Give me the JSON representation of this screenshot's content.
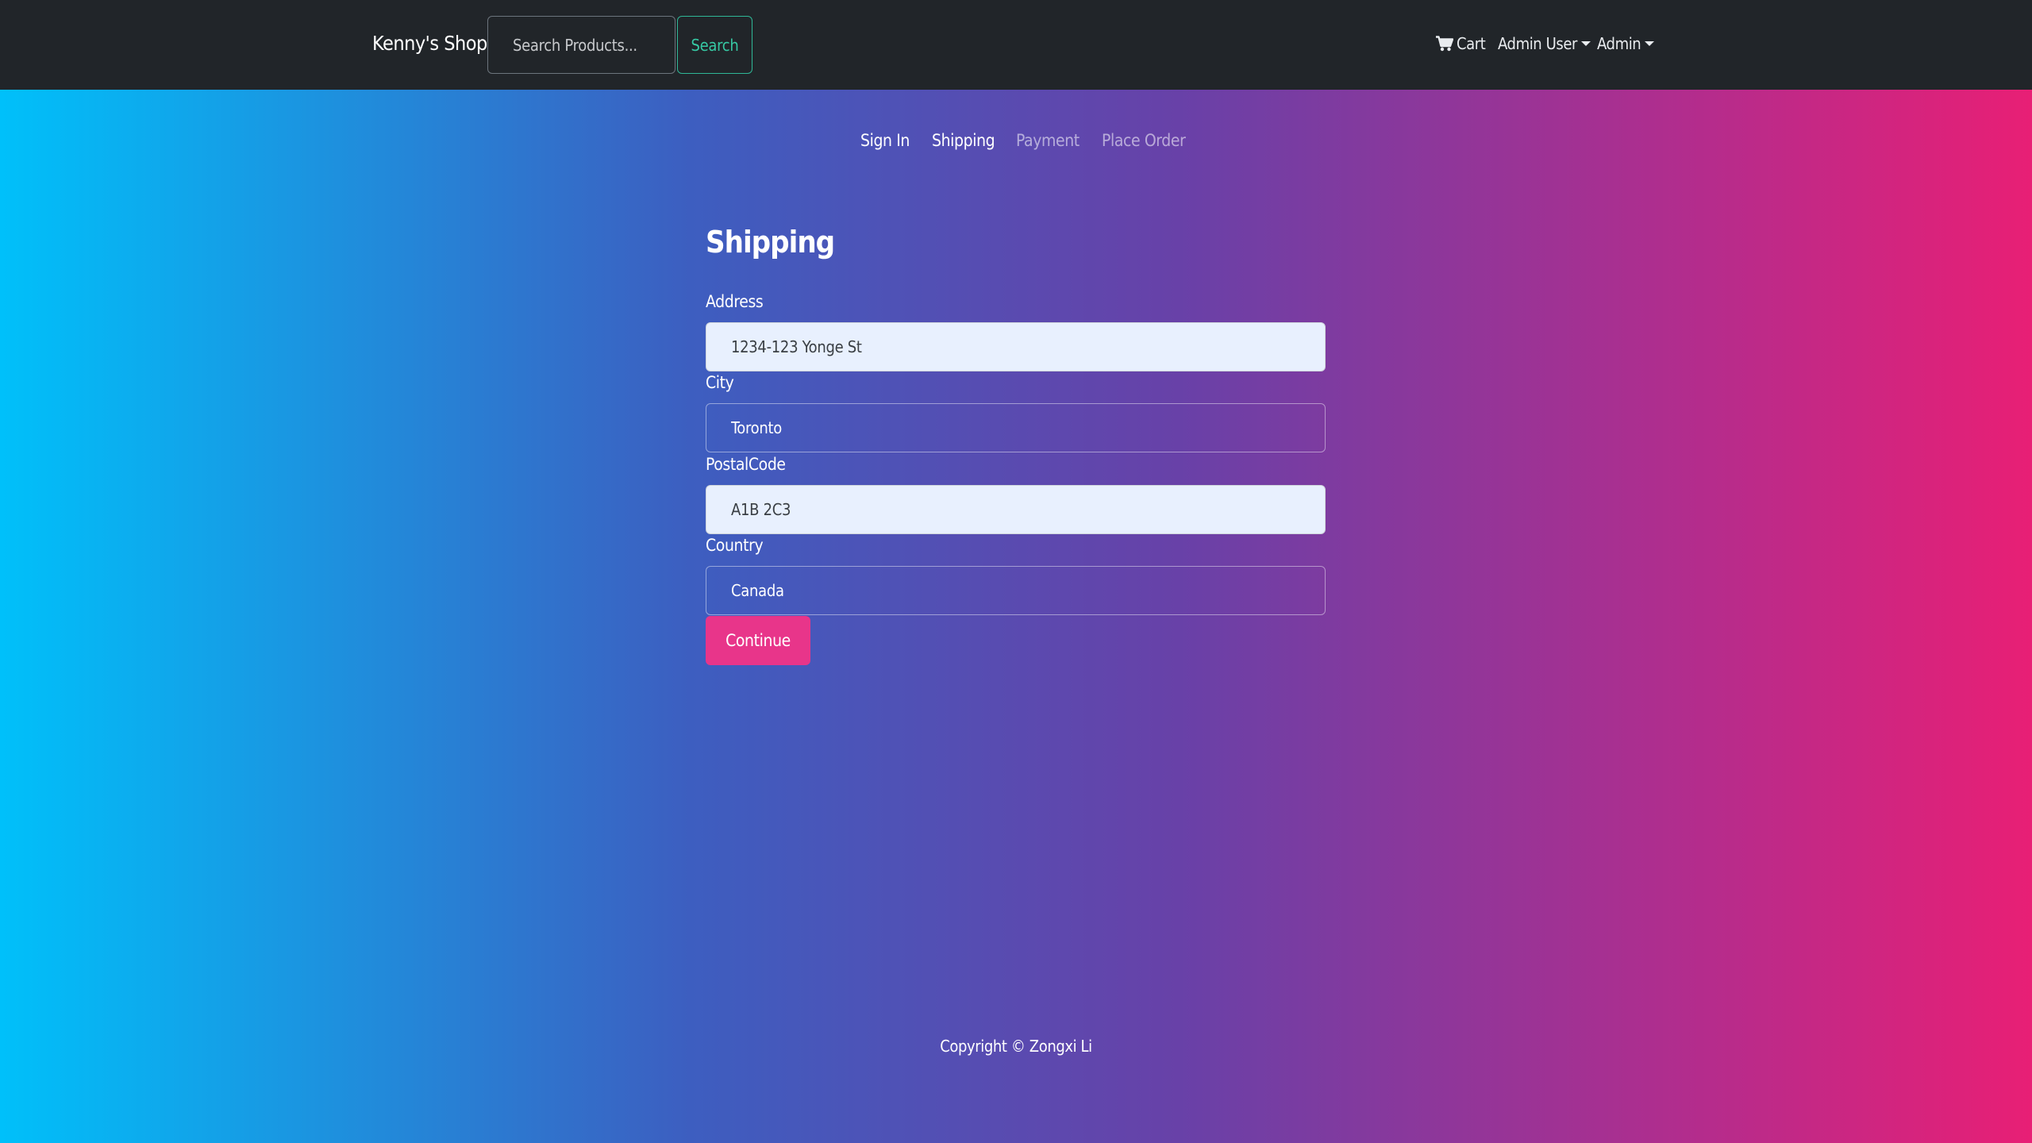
{
  "navbar": {
    "brand": "Kenny's Shop",
    "search_placeholder": "Search Products...",
    "search_button": "Search",
    "cart_label": "Cart",
    "user_menu_label": "Admin User",
    "admin_menu_label": "Admin"
  },
  "steps": [
    {
      "label": "Sign In",
      "state": "active"
    },
    {
      "label": "Shipping",
      "state": "active"
    },
    {
      "label": "Payment",
      "state": "disabled"
    },
    {
      "label": "Place Order",
      "state": "disabled"
    }
  ],
  "form": {
    "title": "Shipping",
    "address_label": "Address",
    "address_value": "1234-123 Yonge St",
    "city_label": "City",
    "city_value": "Toronto",
    "postal_label": "PostalCode",
    "postal_value": "A1B 2C3",
    "country_label": "Country",
    "country_value": "Canada",
    "continue_button": "Continue"
  },
  "footer": {
    "copyright": "Copyright © Zongxi Li"
  },
  "colors": {
    "navbar_bg": "#212529",
    "search_accent": "#36c8a3",
    "continue_button": "#e8358a",
    "gradient_start": "#00c0fa",
    "gradient_end": "#e81f75"
  },
  "icons": {
    "cart": "shopping-cart-icon"
  }
}
